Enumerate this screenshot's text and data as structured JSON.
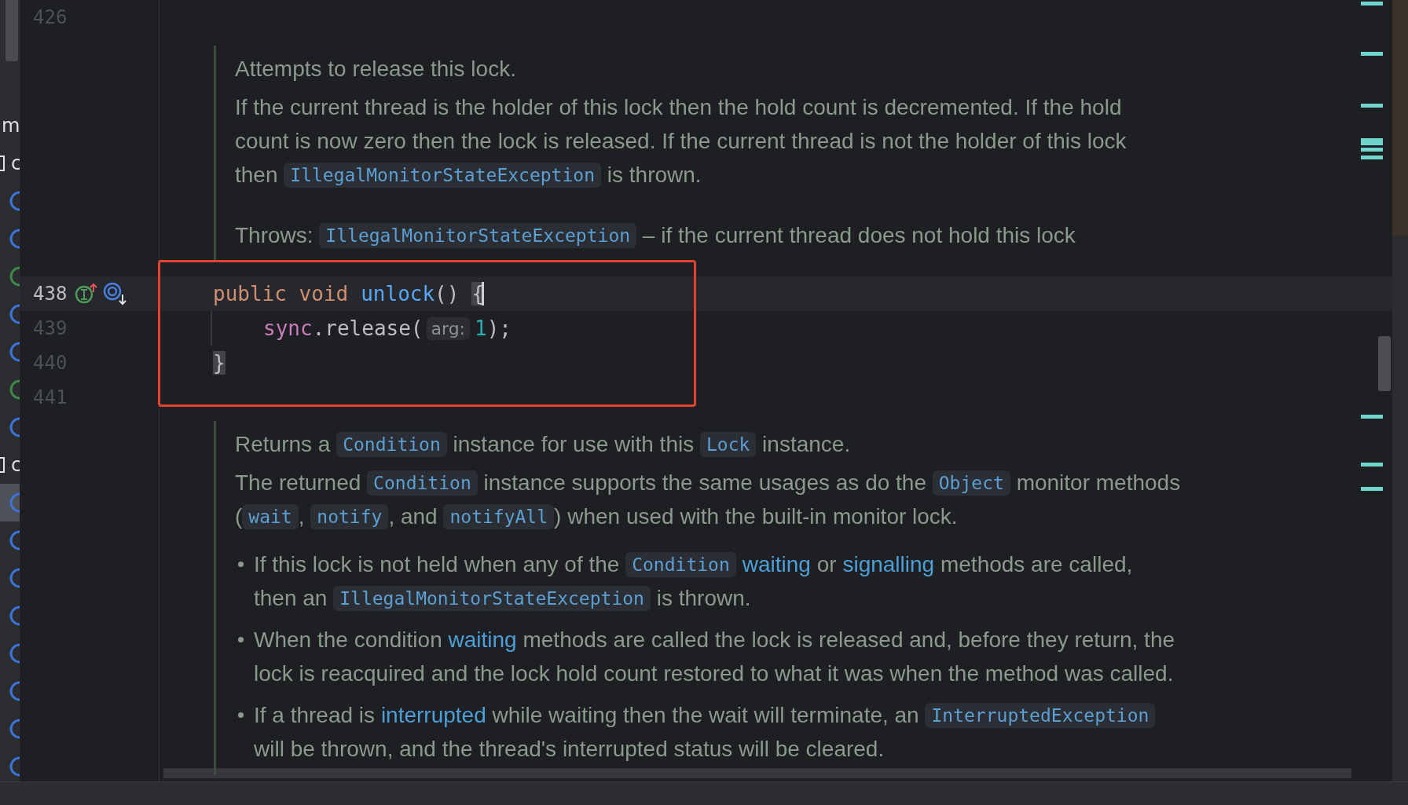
{
  "structure_panel": {
    "items": [
      {
        "kind": "label",
        "text": "m",
        "selected": false
      },
      {
        "kind": "label",
        "text": "c",
        "selected": false
      },
      {
        "kind": "icon",
        "color": "#3d74d9",
        "selected": false
      },
      {
        "kind": "icon",
        "color": "#3d74d9",
        "selected": false
      },
      {
        "kind": "icon",
        "color": "#3e8a4a",
        "selected": false
      },
      {
        "kind": "icon",
        "color": "#3d74d9",
        "selected": false
      },
      {
        "kind": "icon",
        "color": "#3d74d9",
        "selected": false
      },
      {
        "kind": "icon",
        "color": "#3e8a4a",
        "selected": false
      },
      {
        "kind": "icon",
        "color": "#3d74d9",
        "selected": false
      },
      {
        "kind": "label",
        "text": "c",
        "selected": false
      },
      {
        "kind": "icon",
        "color": "#3d74d9",
        "selected": true
      },
      {
        "kind": "icon",
        "color": "#3d74d9",
        "selected": false
      },
      {
        "kind": "icon",
        "color": "#3d74d9",
        "selected": false
      },
      {
        "kind": "icon",
        "color": "#3d74d9",
        "selected": false
      },
      {
        "kind": "icon",
        "color": "#3d74d9",
        "selected": false
      },
      {
        "kind": "icon",
        "color": "#3d74d9",
        "selected": false
      },
      {
        "kind": "icon",
        "color": "#3d74d9",
        "selected": false
      },
      {
        "kind": "icon",
        "color": "#3d74d9",
        "selected": false
      }
    ]
  },
  "editor": {
    "first_line_number": "426",
    "doc_before": [
      {
        "kind": "summary",
        "lines": [
          [
            {
              "kind": "text",
              "text": "Attempts to release this lock."
            }
          ]
        ]
      },
      {
        "kind": "para",
        "lines": [
          [
            {
              "kind": "text",
              "text": "If the current thread is the holder of this lock then the hold count is decremented. If the hold"
            }
          ],
          [
            {
              "kind": "text",
              "text": "count is now zero then the lock is released. If the current thread is not the holder of this lock"
            }
          ],
          [
            {
              "kind": "text",
              "text": "then "
            },
            {
              "kind": "code",
              "text": "IllegalMonitorStateException"
            },
            {
              "kind": "text",
              "text": " is thrown."
            }
          ]
        ]
      },
      {
        "kind": "throws",
        "lines": [
          [
            {
              "kind": "text",
              "text": "Throws: "
            },
            {
              "kind": "code",
              "text": "IllegalMonitorStateException"
            },
            {
              "kind": "text",
              "text": " – if the current thread does not hold this lock"
            }
          ]
        ]
      }
    ],
    "code_lines": [
      {
        "number": "438",
        "current": true,
        "markers": true,
        "indented": false,
        "tokens": [
          {
            "kind": "keyword",
            "text": "public void"
          },
          {
            "kind": "method",
            "text": "unlock"
          },
          {
            "kind": "plain",
            "text": "()"
          },
          {
            "kind": "brace",
            "text": "{"
          }
        ]
      },
      {
        "number": "439",
        "current": false,
        "markers": false,
        "indented": true,
        "tokens": [
          {
            "kind": "field",
            "text": "sync"
          },
          {
            "kind": "plain",
            "text": ".release("
          },
          {
            "kind": "hint",
            "text": "arg:"
          },
          {
            "kind": "number",
            "text": "1"
          },
          {
            "kind": "plain",
            "text": ");"
          }
        ]
      },
      {
        "number": "440",
        "current": false,
        "markers": false,
        "indented": false,
        "tokens": [
          {
            "kind": "brace",
            "text": "}"
          }
        ]
      },
      {
        "number": "441",
        "current": false,
        "markers": false
      }
    ],
    "doc_after": [
      {
        "kind": "summary",
        "lines": [
          [
            {
              "kind": "text",
              "text": "Returns a "
            },
            {
              "kind": "code",
              "text": "Condition"
            },
            {
              "kind": "text",
              "text": " instance for use with this "
            },
            {
              "kind": "code",
              "text": "Lock"
            },
            {
              "kind": "text",
              "text": " instance."
            }
          ]
        ]
      },
      {
        "kind": "para",
        "lines": [
          [
            {
              "kind": "text",
              "text": "The returned "
            },
            {
              "kind": "code",
              "text": "Condition"
            },
            {
              "kind": "text",
              "text": " instance supports the same usages as do the "
            },
            {
              "kind": "code",
              "text": "Object"
            },
            {
              "kind": "text",
              "text": " monitor methods"
            }
          ],
          [
            {
              "kind": "text",
              "text": "("
            },
            {
              "kind": "code",
              "text": "wait"
            },
            {
              "kind": "text",
              "text": ", "
            },
            {
              "kind": "code",
              "text": "notify"
            },
            {
              "kind": "text",
              "text": ", and "
            },
            {
              "kind": "code",
              "text": "notifyAll"
            },
            {
              "kind": "text",
              "text": ") when used with the built-in monitor lock."
            }
          ]
        ]
      },
      {
        "kind": "bullet",
        "lines": [
          [
            {
              "kind": "text",
              "text": "If this lock is not held when any of the "
            },
            {
              "kind": "code",
              "text": "Condition"
            },
            {
              "kind": "link",
              "text": "waiting"
            },
            {
              "kind": "text",
              "text": " or "
            },
            {
              "kind": "link",
              "text": "signalling"
            },
            {
              "kind": "text",
              "text": " methods are called,"
            }
          ],
          [
            {
              "kind": "text",
              "text": "then an "
            },
            {
              "kind": "code",
              "text": "IllegalMonitorStateException"
            },
            {
              "kind": "text",
              "text": " is thrown."
            }
          ]
        ]
      },
      {
        "kind": "bullet",
        "lines": [
          [
            {
              "kind": "text",
              "text": "When the condition "
            },
            {
              "kind": "link",
              "text": "waiting"
            },
            {
              "kind": "text",
              "text": " methods are called the lock is released and, before they return, the"
            }
          ],
          [
            {
              "kind": "text",
              "text": "lock is reacquired and the lock hold count restored to what it was when the method was called."
            }
          ]
        ]
      },
      {
        "kind": "bullet",
        "lines": [
          [
            {
              "kind": "text",
              "text": "If a thread is "
            },
            {
              "kind": "link",
              "text": "interrupted"
            },
            {
              "kind": "text",
              "text": " while waiting then the wait will terminate, an "
            },
            {
              "kind": "code",
              "text": "InterruptedException"
            }
          ],
          [
            {
              "kind": "text",
              "text": "will be thrown, and the thread's interrupted status will be cleared."
            }
          ]
        ]
      }
    ]
  }
}
